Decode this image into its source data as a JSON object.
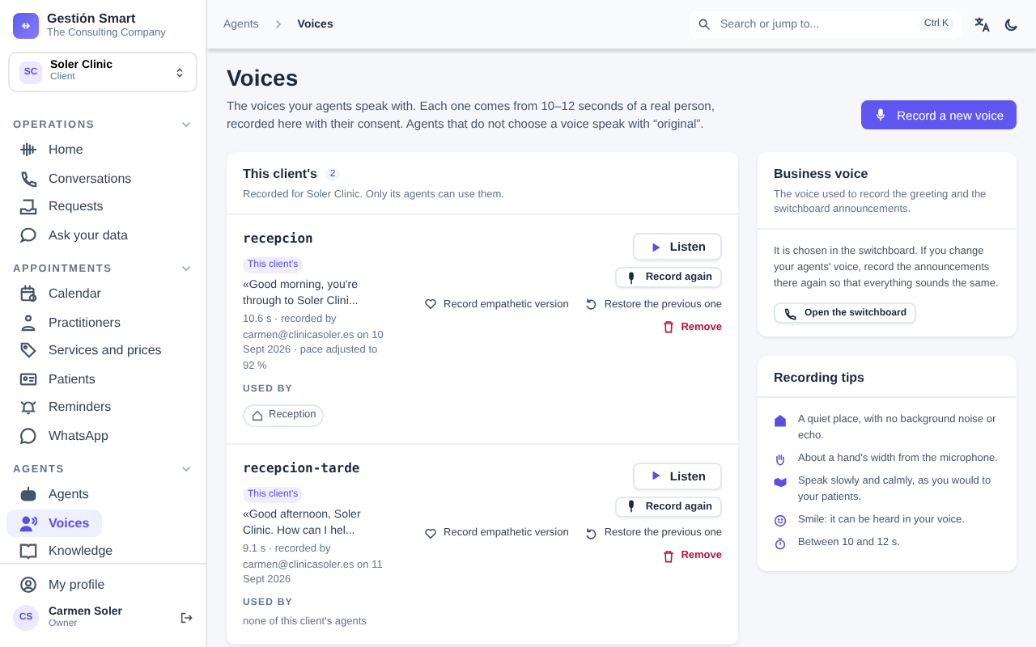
{
  "app": {
    "name": "Gestión Smart",
    "company": "The Consulting Company"
  },
  "client_switcher": {
    "initials": "SC",
    "name": "Soler Clinic",
    "role": "Client"
  },
  "sidebar": {
    "sections": [
      {
        "title": "OPERATIONS",
        "expanded": true,
        "items": [
          {
            "label": "Home",
            "selected": false
          },
          {
            "label": "Conversations",
            "selected": false
          },
          {
            "label": "Requests",
            "selected": false
          },
          {
            "label": "Ask your data",
            "selected": false
          }
        ]
      },
      {
        "title": "APPOINTMENTS",
        "expanded": true,
        "items": [
          {
            "label": "Calendar",
            "selected": false
          },
          {
            "label": "Practitioners",
            "selected": false
          },
          {
            "label": "Services and prices",
            "selected": false
          },
          {
            "label": "Patients",
            "selected": false
          },
          {
            "label": "Reminders",
            "selected": false
          },
          {
            "label": "WhatsApp",
            "selected": false
          }
        ]
      },
      {
        "title": "AGENTS",
        "expanded": true,
        "items": [
          {
            "label": "Agents",
            "selected": false
          },
          {
            "label": "Voices",
            "selected": true
          },
          {
            "label": "Knowledge",
            "selected": false
          }
        ]
      }
    ],
    "profile_link": "My profile",
    "user": {
      "initials": "CS",
      "name": "Carmen Soler",
      "role": "Owner"
    }
  },
  "topbar": {
    "breadcrumb": [
      "Agents",
      "Voices"
    ],
    "search": {
      "placeholder": "Search or jump to...",
      "shortcut": "Ctrl K"
    }
  },
  "page": {
    "title": "Voices",
    "description": "The voices your agents speak with. Each one comes from 10–12 seconds of a real person, recorded here with their consent. Agents that do not choose a voice speak with “original”.",
    "primary_button": "Record a new voice"
  },
  "voices_card": {
    "title": "This client's",
    "count": "2",
    "subtitle": "Recorded for Soler Clinic. Only its agents can use them.",
    "voices": [
      {
        "name": "recepcion",
        "tag": "This client's",
        "quote": "«Good morning, you're through to Soler Clini...",
        "meta": "10.6 s · recorded by carmen@clinicasoler.es on 10 Sept 2026 · pace adjusted to 92 %",
        "used_by_label": "USED BY",
        "used_by": [
          "Reception"
        ],
        "actions": {
          "listen": "Listen",
          "record_again": "Record again",
          "empathetic": "Record empathetic version",
          "restore": "Restore the previous one",
          "remove": "Remove"
        }
      },
      {
        "name": "recepcion-tarde",
        "tag": "This client's",
        "quote": "«Good afternoon, Soler Clinic. How can I hel...",
        "meta": "9.1 s · recorded by carmen@clinicasoler.es on 11 Sept 2026",
        "used_by_label": "USED BY",
        "used_by_empty": "none of this client's agents",
        "actions": {
          "listen": "Listen",
          "record_again": "Record again",
          "empathetic": "Record empathetic version",
          "restore": "Restore the previous one",
          "remove": "Remove"
        }
      }
    ]
  },
  "business_voice": {
    "title": "Business voice",
    "subtitle": "The voice used to record the greeting and the switchboard announcements.",
    "body": "It is chosen in the switchboard. If you change your agents' voice, record the announcements there again so that everything sounds the same.",
    "button": "Open the switchboard"
  },
  "tips": {
    "title": "Recording tips",
    "items": [
      "A quiet place, with no background noise or echo.",
      "About a hand's width from the microphone.",
      "Speak slowly and calmly, as you would to your patients.",
      "Smile: it can be heard in your voice.",
      "Between 10 and 12 s."
    ]
  }
}
